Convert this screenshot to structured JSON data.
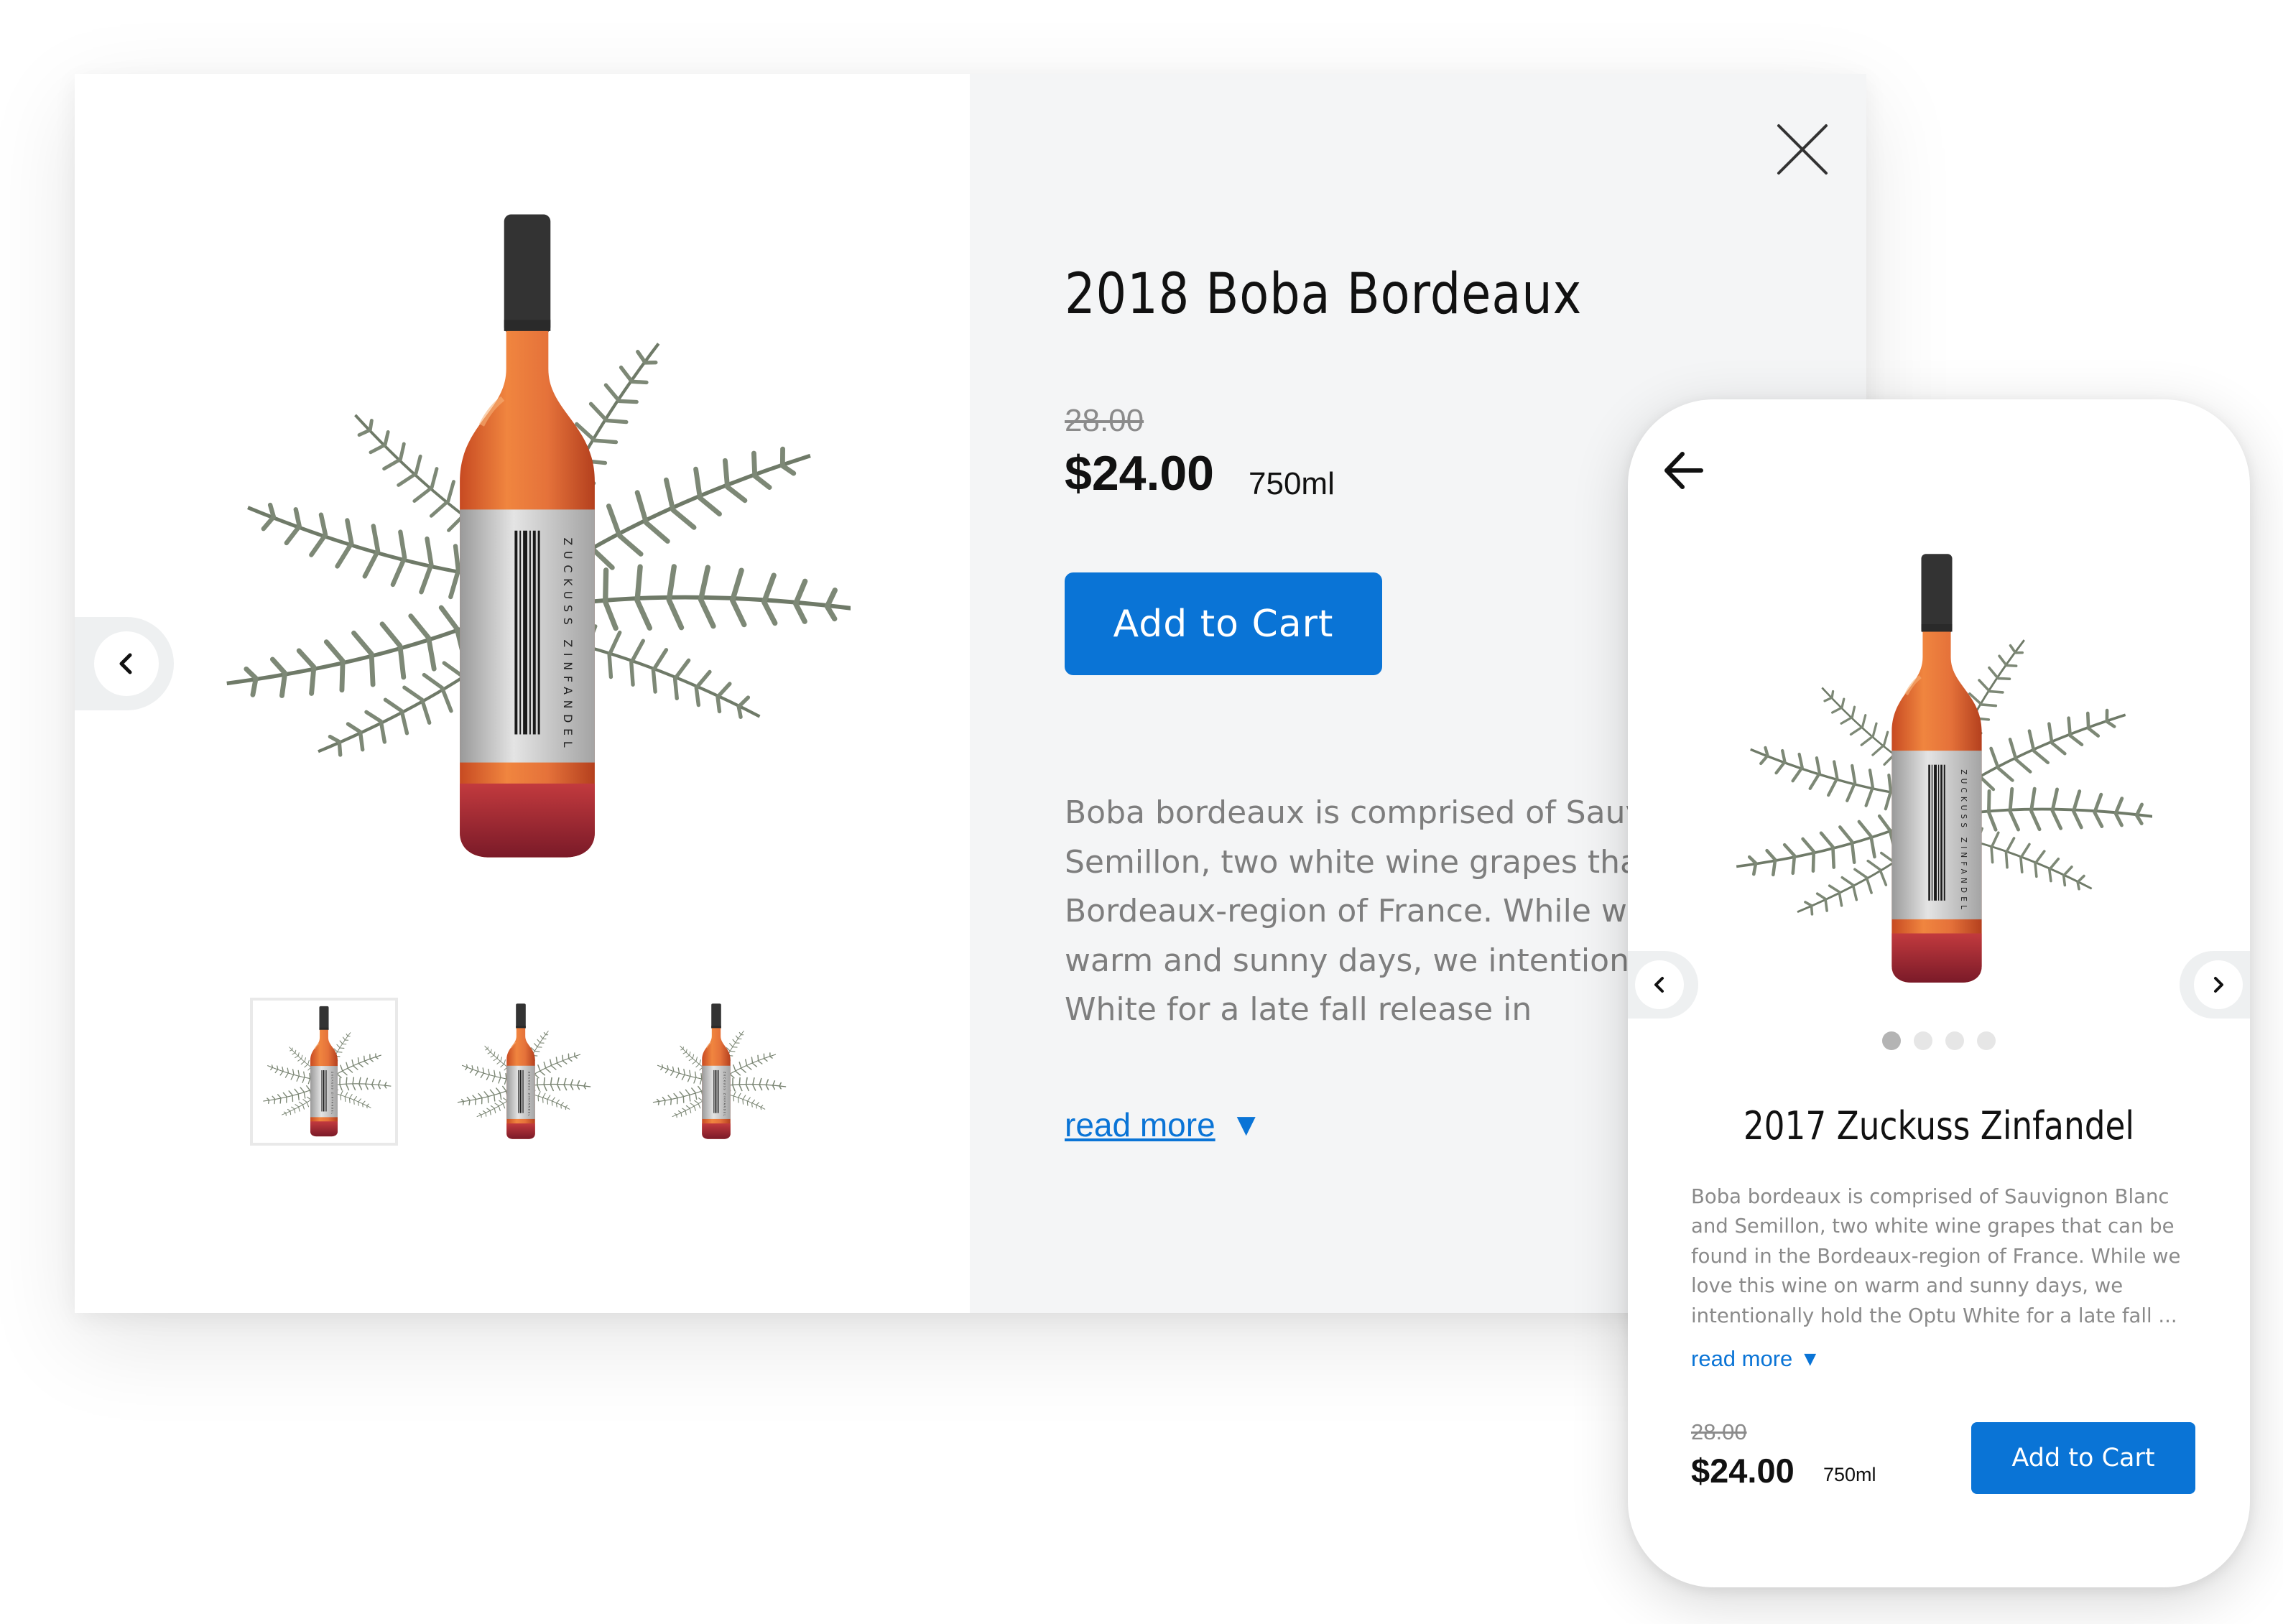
{
  "desktop_modal": {
    "title": "2018 Boba Bordeaux",
    "original_price": "28.00",
    "price": "$24.00",
    "size": "750ml",
    "add_to_cart_label": "Add to Cart",
    "description": "Boba bordeaux is comprised of Sauvignon Blanc and Semillon, two white wine grapes that can be found in the Bordeaux-region of France. While we love this wine on warm and sunny days, we intentionally hold the Optu White for a late fall release in",
    "read_more_label": "read more",
    "bottle_label_text": "ZUCKUSS ZINFANDEL",
    "thumbnail_count": 3,
    "selected_thumbnail": 1,
    "icons": {
      "close": "close-icon",
      "prev": "chevron-left-icon",
      "read_more": "caret-down-icon"
    }
  },
  "mobile": {
    "title": "2017 Zuckuss Zinfandel",
    "description": "Boba bordeaux is comprised of Sauvignon Blanc and Semillon, two white wine grapes that can be found in the Bordeaux-region of France. While we love this wine on warm and sunny days, we intentionally hold the Optu White for a late fall ...",
    "read_more_label": "read more",
    "original_price": "28.00",
    "price": "$24.00",
    "size": "750ml",
    "add_to_cart_label": "Add to Cart",
    "carousel_dots": 4,
    "active_dot": 1,
    "icons": {
      "back": "arrow-left-icon",
      "prev": "chevron-left-icon",
      "next": "chevron-right-icon",
      "read_more": "caret-down-icon"
    }
  },
  "colors": {
    "accent": "#0a74d6",
    "panel_background": "#f4f5f6",
    "wine": "#e0703a",
    "capsule": "#3a3a3a",
    "label": "#c8c8c8",
    "fern": "#6f7a68"
  }
}
